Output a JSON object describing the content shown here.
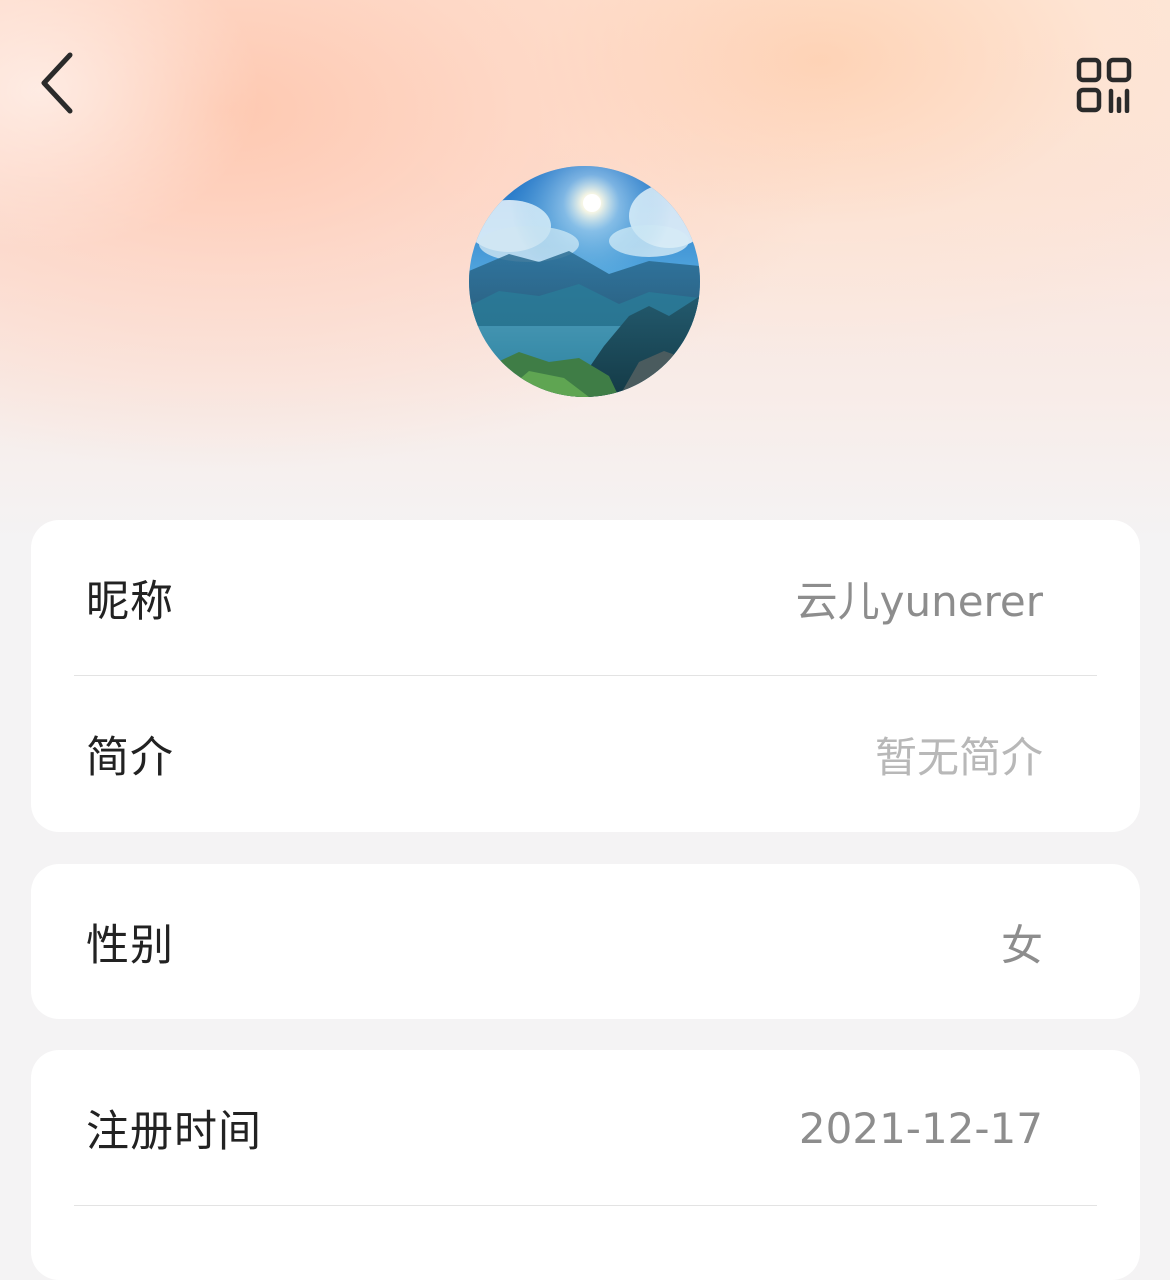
{
  "header": {
    "back_icon": "chevron-left-icon",
    "qr_icon": "qr-code-icon"
  },
  "profile": {
    "avatar": "mountain-landscape-avatar"
  },
  "card_basic": {
    "nickname_label": "昵称",
    "nickname_value": "云儿yunerer",
    "bio_label": "简介",
    "bio_value": "暂无简介"
  },
  "card_gender": {
    "gender_label": "性别",
    "gender_value": "女"
  },
  "card_registration": {
    "reg_label": "注册时间",
    "reg_value": "2021-12-17"
  },
  "colors": {
    "page_bg": "#f4f3f4",
    "card_bg": "#ffffff",
    "label_text": "#222222",
    "value_text": "#8d8d8d",
    "placeholder_text": "#b8b8b8"
  }
}
